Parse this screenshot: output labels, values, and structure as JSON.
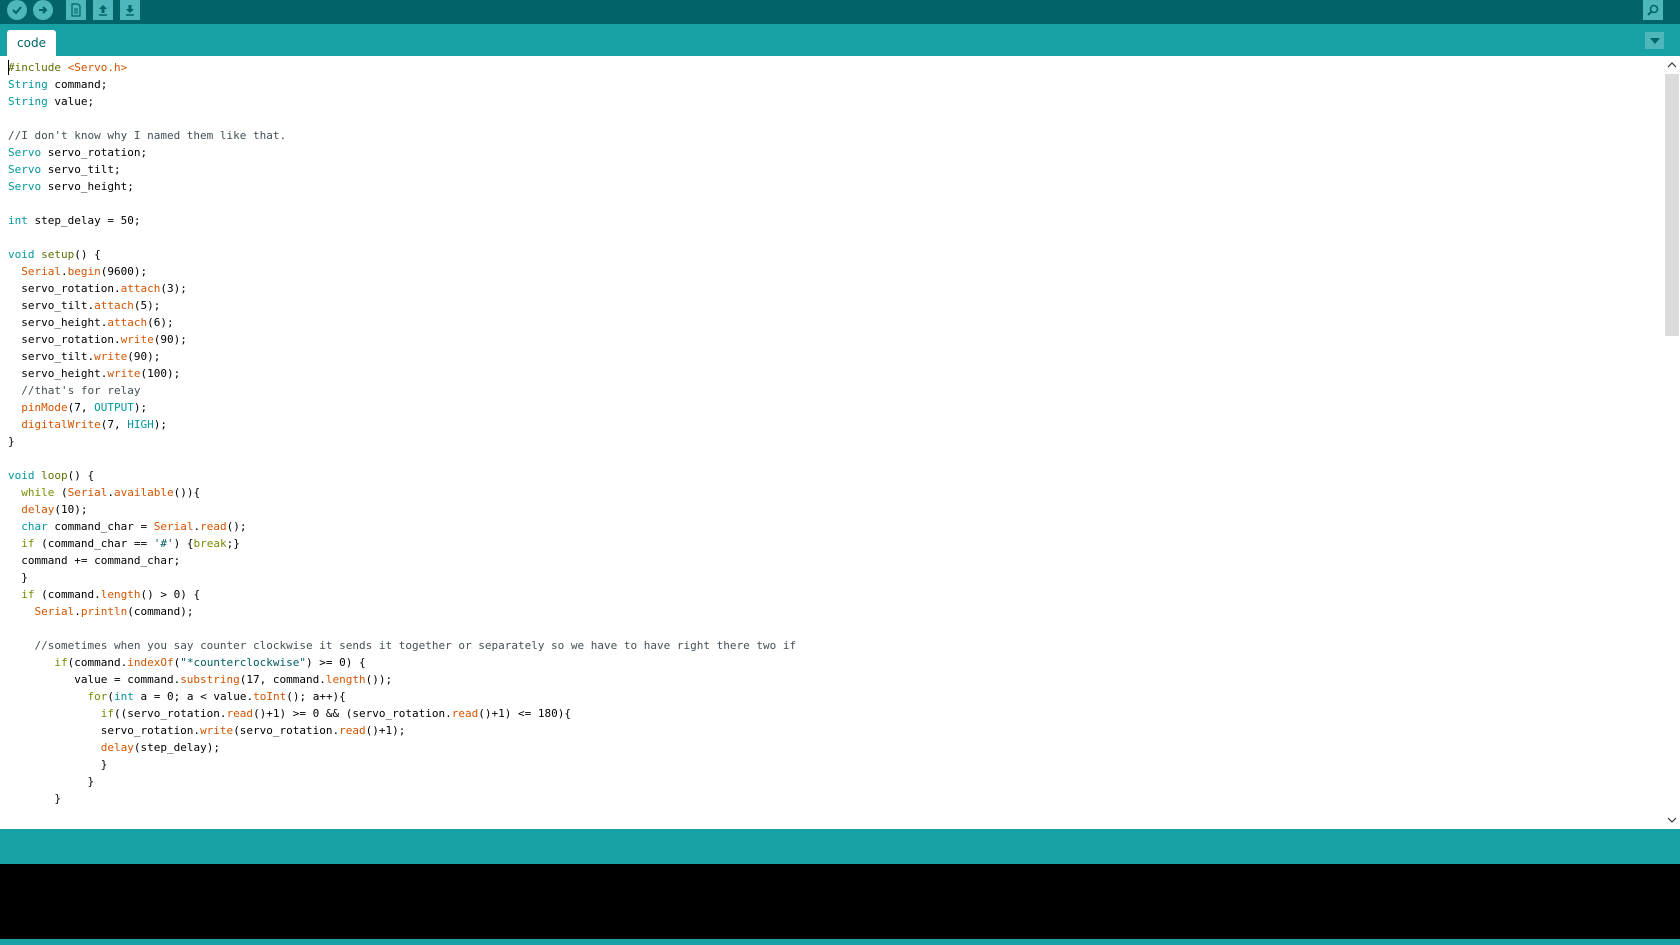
{
  "toolbar": {
    "buttons": [
      {
        "name": "verify",
        "icon": "checkmark-icon"
      },
      {
        "name": "upload",
        "icon": "arrow-right-icon"
      },
      {
        "name": "new",
        "icon": "new-file-icon"
      },
      {
        "name": "open",
        "icon": "arrow-up-icon"
      },
      {
        "name": "save",
        "icon": "arrow-down-icon"
      },
      {
        "name": "serial-monitor",
        "icon": "magnifier-icon"
      }
    ]
  },
  "tabs": [
    {
      "label": "code"
    }
  ],
  "colors": {
    "toolbar": "#006468",
    "tabbar": "#17a1a5",
    "button": "#4db7bb",
    "console": "#000000"
  },
  "editor": {
    "lines": [
      "#include <Servo.h>",
      "String command;",
      "String value;",
      "",
      "//I don't know why I named them like that.",
      "Servo servo_rotation;",
      "Servo servo_tilt;",
      "Servo servo_height;",
      "",
      "int step_delay = 50;",
      "",
      "void setup() {",
      "  Serial.begin(9600);",
      "  servo_rotation.attach(3);",
      "  servo_tilt.attach(5);",
      "  servo_height.attach(6);",
      "  servo_rotation.write(90);",
      "  servo_tilt.write(90);",
      "  servo_height.write(100);",
      "  //that's for relay",
      "  pinMode(7, OUTPUT);",
      "  digitalWrite(7, HIGH);",
      "}",
      "",
      "void loop() {",
      "  while (Serial.available()){",
      "  delay(10);",
      "  char command_char = Serial.read();",
      "  if (command_char == '#') {break;}",
      "  command += command_char;",
      "  }",
      "  if (command.length() > 0) {",
      "    Serial.println(command);",
      "",
      "    //sometimes when you say counter clockwise it sends it together or separately so we have to have right there two if",
      "       if(command.indexOf(\"*counterclockwise\") >= 0) {",
      "          value = command.substring(17, command.length());",
      "            for(int a = 0; a < value.toInt(); a++){",
      "              if((servo_rotation.read()+1) >= 0 && (servo_rotation.read()+1) <= 180){",
      "              servo_rotation.write(servo_rotation.read()+1);",
      "              delay(step_delay);",
      "              }",
      "            }",
      "       }"
    ]
  }
}
